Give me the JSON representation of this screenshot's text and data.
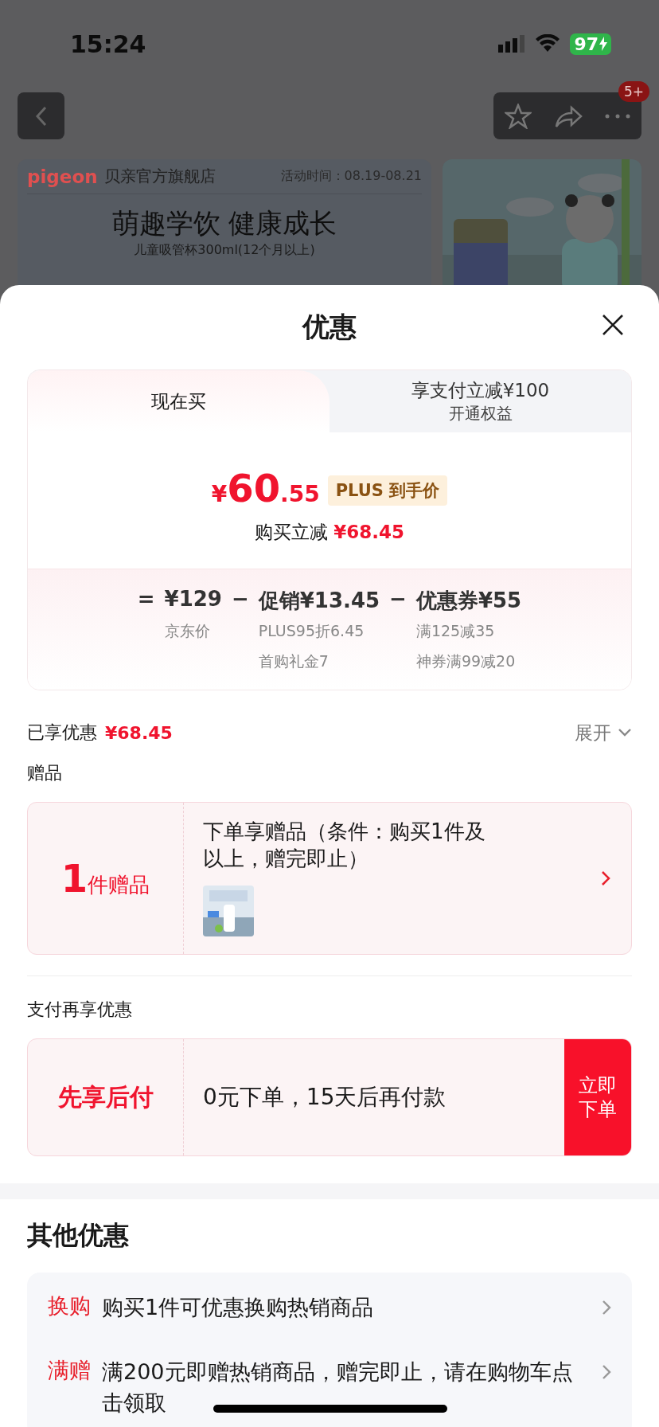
{
  "status_bar": {
    "time": "15:24",
    "battery": "97"
  },
  "nav": {
    "badge": "5+"
  },
  "store_banner": {
    "logo": "pigeon",
    "store": "贝亲官方旗舰店",
    "period": "活动时间：08.19-08.21",
    "headline": "萌趣学饮 健康成长",
    "subtitle": "儿童吸管杯300ml(12个月以上)"
  },
  "sheet": {
    "title": "优惠"
  },
  "tabs": [
    {
      "label": "现在买",
      "selected": true
    },
    {
      "label": "享支付立减¥100",
      "sublabel": "开通权益",
      "selected": false
    }
  ],
  "price": {
    "currency": "¥",
    "integer": "60",
    "decimal": ".55",
    "tag": "PLUS 到手价",
    "saving_label": "购买立减",
    "saving": "¥68.45"
  },
  "breakdown": [
    {
      "operator": "=",
      "amount": "¥129",
      "notes": [
        "京东价"
      ]
    },
    {
      "operator": "−",
      "amount": "促销¥13.45",
      "notes": [
        "PLUS95折6.45",
        "首购礼金7"
      ]
    },
    {
      "operator": "−",
      "amount": "优惠券¥55",
      "notes": [
        "满125减35",
        "神券满99减20"
      ]
    }
  ],
  "enjoyed": {
    "label": "已享优惠",
    "amount": "¥68.45",
    "toggle": "展开"
  },
  "gifts": {
    "heading": "赠品",
    "count": "1",
    "unit": "件赠品",
    "description": "下单享赠品（条件：购买1件及以上，赠完即止）"
  },
  "pay_later": {
    "heading": "支付再享优惠",
    "name": "先享后付",
    "description": "0元下单，15天后再付款",
    "button": "立即下单"
  },
  "other": {
    "heading": "其他优惠",
    "items": [
      {
        "tag": "换购",
        "text": "购买1件可优惠换购热销商品"
      },
      {
        "tag": "满赠",
        "text": "满200元即赠热销商品，赠完即止，请在购物车点击领取"
      }
    ]
  }
}
